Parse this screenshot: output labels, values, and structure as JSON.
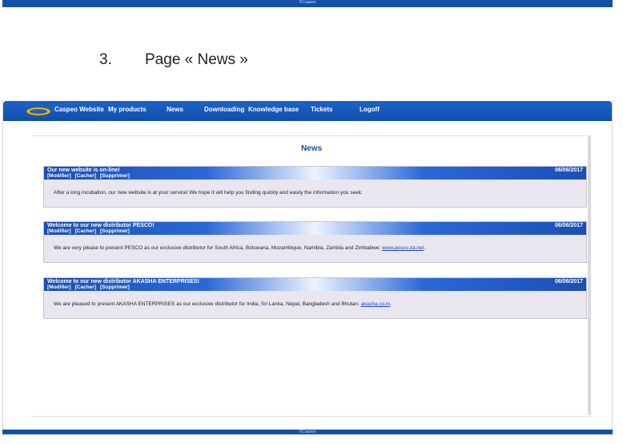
{
  "footer_watermark": "©Caspeo",
  "section": {
    "number": "3.",
    "title": "Page « News »"
  },
  "nav": {
    "items": [
      "Caspeo Website",
      "My products",
      "News",
      "Downloading",
      "Knowledge base",
      "Tickets",
      "Logoff"
    ]
  },
  "news": {
    "title": "News",
    "actions": [
      "[Modifier]",
      "[Cacher]",
      "[Supprimer]"
    ],
    "items": [
      {
        "title": "Our new website is on-line!",
        "date": "06/06/2017",
        "text": "After a long incubation, our new website is at your service! We hope it will help you finding quickly and easily the information you seek.",
        "link": ""
      },
      {
        "title": "Welcome to our new distributor PESCO!",
        "date": "06/06/2017",
        "text": "We are very please to present PESCO as our exclusive distributor for South Africa, Botswana, Mozambique, Namibia, Zambia and Zimbabwe: ",
        "link": "www.pesco.za.net"
      },
      {
        "title": "Welcome to our new distributor AKASHA ENTERPRISES!",
        "date": "06/06/2017",
        "text": "We are pleased to present AKASHA ENTERPRISES as our exclusive distributor for India, Sri Lanka, Nepal, Bangladesh and Bhutan: ",
        "link": "akasha.co.in"
      }
    ]
  }
}
